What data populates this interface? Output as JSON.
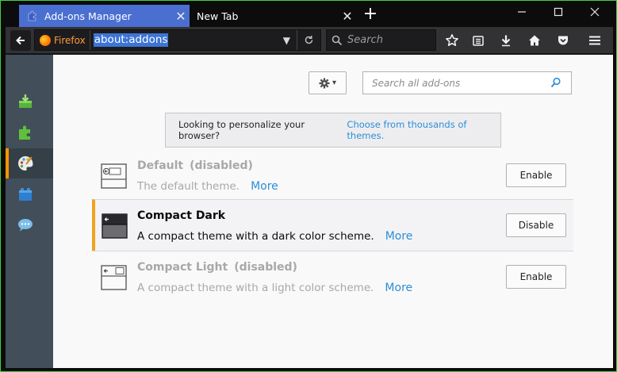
{
  "tabs": [
    {
      "label": "Add-ons Manager",
      "active": true
    },
    {
      "label": "New Tab",
      "active": false
    }
  ],
  "navbar": {
    "identity_label": "Firefox",
    "url": "about:addons",
    "search_placeholder": "Search"
  },
  "window_controls": {
    "minimize": "—",
    "maximize": "☐",
    "close": "✕"
  },
  "sidebar": {
    "items": [
      {
        "name": "get-addons",
        "icon": "download-box-icon"
      },
      {
        "name": "extensions",
        "icon": "puzzle-piece-icon"
      },
      {
        "name": "themes",
        "icon": "palette-icon",
        "selected": true
      },
      {
        "name": "plugins",
        "icon": "lego-brick-icon"
      },
      {
        "name": "services",
        "icon": "speech-bubble-icon"
      }
    ]
  },
  "main": {
    "search_placeholder": "Search all add-ons",
    "banner": {
      "text": "Looking to personalize your browser?",
      "link": "Choose from thousands of themes."
    },
    "themes": [
      {
        "name": "Default",
        "status": "(disabled)",
        "description": "The default theme.",
        "more": "More",
        "button": "Enable",
        "state": "disabled"
      },
      {
        "name": "Compact Dark",
        "status": "",
        "description": "A compact theme with a dark color scheme.",
        "more": "More",
        "button": "Disable",
        "state": "enabled"
      },
      {
        "name": "Compact Light",
        "status": "(disabled)",
        "description": "A compact theme with a light color scheme.",
        "more": "More",
        "button": "Enable",
        "state": "disabled"
      }
    ]
  },
  "colors": {
    "accent_tab": "#4a6fd1",
    "link": "#2b8fd6",
    "selected_marker": "#f0a21d",
    "sidebar_bg": "#424f5a",
    "frame_border": "#3fd43f"
  }
}
